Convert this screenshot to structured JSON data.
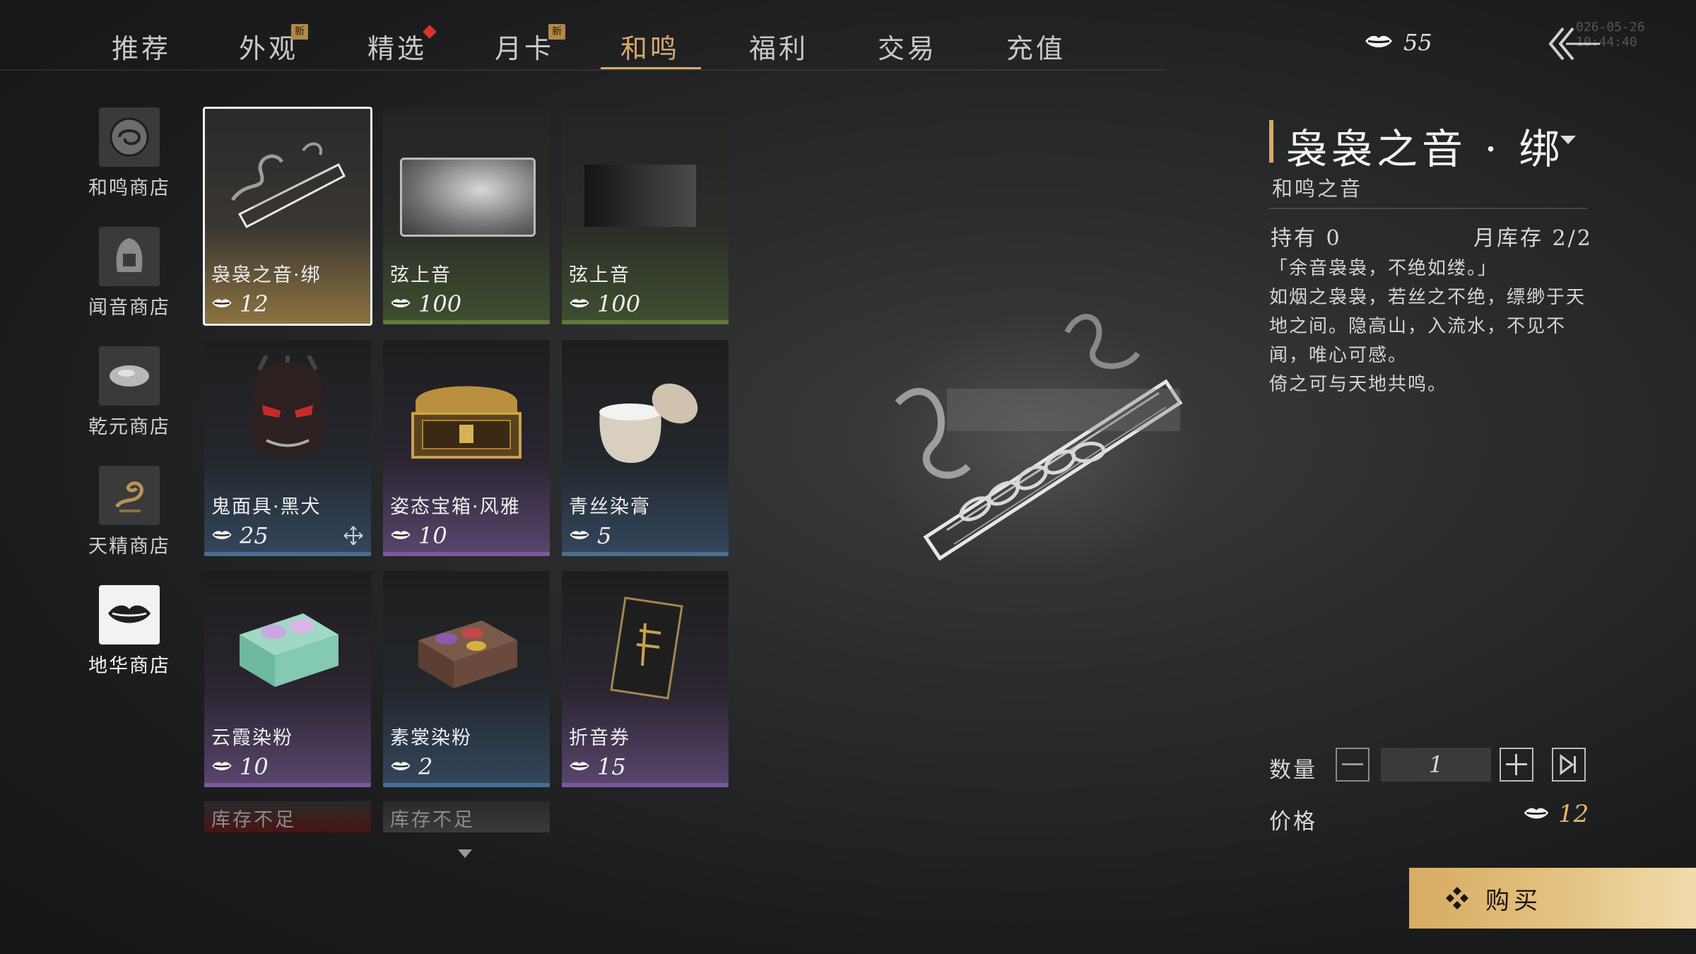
{
  "nav": {
    "tabs": [
      {
        "label": "推荐"
      },
      {
        "label": "外观",
        "badge": "新"
      },
      {
        "label": "精选"
      },
      {
        "label": "月卡",
        "badge": "新"
      },
      {
        "label": "和鸣"
      },
      {
        "label": "福利"
      },
      {
        "label": "交易"
      },
      {
        "label": "充值"
      }
    ],
    "active_tab": "和鸣",
    "currency_amount": "55",
    "timestamp": "026-05-26 10:44:40"
  },
  "sidebar": {
    "items": [
      {
        "label": "和鸣商店",
        "icon": "swirl-emblem-icon"
      },
      {
        "label": "闻音商店",
        "icon": "seal-stone-icon"
      },
      {
        "label": "乾元商店",
        "icon": "jade-pebble-icon"
      },
      {
        "label": "天精商店",
        "icon": "dragon-icon"
      },
      {
        "label": "地华商店",
        "icon": "lips-icon",
        "selected": true
      }
    ]
  },
  "grid": {
    "items": [
      {
        "name": "袅袅之音·绑",
        "price": "12",
        "selected": true,
        "color": "#a68a4e"
      },
      {
        "name": "弦上音",
        "price": "100",
        "color": "#5f7a3a"
      },
      {
        "name": "弦上音",
        "price": "100",
        "color": "#5f7a3a"
      },
      {
        "name": "鬼面具·黑犬",
        "price": "25",
        "color": "#4a6d92"
      },
      {
        "name": "姿态宝箱·风雅",
        "price": "10",
        "color": "#7a5a9a"
      },
      {
        "name": "青丝染膏",
        "price": "5",
        "color": "#4a6d92"
      },
      {
        "name": "云霞染粉",
        "price": "10",
        "color": "#7a5a9a"
      },
      {
        "name": "素裳染粉",
        "price": "2",
        "color": "#4a6d92"
      },
      {
        "name": "折音券",
        "price": "15",
        "color": "#7a5a9a"
      }
    ],
    "out_of_stock_label": "库存不足"
  },
  "detail": {
    "title": "袅袅之音 · 绑",
    "subtitle": "和鸣之音",
    "owned": "持有 0",
    "monthly_stock": "月库存 2/2",
    "description": [
      "「余音袅袅，不绝如缕。」",
      "如烟之袅袅，若丝之不绝，缥缈于天",
      "地之间。隐高山，入流水，不见不",
      "闻，唯心可感。",
      "倚之可与天地共鸣。"
    ],
    "quantity_label": "数量",
    "quantity": "1",
    "price_label": "价格",
    "price": "12",
    "buy_label": "购买"
  },
  "colors": {
    "accent_gold": "#d9a86c",
    "price_gold": "#e6b66a"
  }
}
